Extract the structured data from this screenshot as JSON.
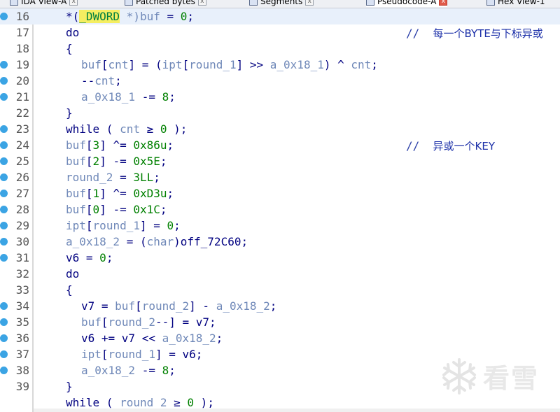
{
  "tabs": [
    {
      "label": "IDA View-A",
      "active": false
    },
    {
      "label": "Patched bytes",
      "active": false
    },
    {
      "label": "Segments",
      "active": false
    },
    {
      "label": "Pseudocode-A",
      "active": true
    },
    {
      "label": "Hex View-1",
      "active": false
    }
  ],
  "lines": [
    {
      "num": "16",
      "bp": true
    },
    {
      "num": "17",
      "bp": false
    },
    {
      "num": "18",
      "bp": false
    },
    {
      "num": "19",
      "bp": true
    },
    {
      "num": "20",
      "bp": true
    },
    {
      "num": "21",
      "bp": true
    },
    {
      "num": "22",
      "bp": false
    },
    {
      "num": "23",
      "bp": true
    },
    {
      "num": "24",
      "bp": true
    },
    {
      "num": "25",
      "bp": true
    },
    {
      "num": "26",
      "bp": true
    },
    {
      "num": "27",
      "bp": true
    },
    {
      "num": "28",
      "bp": true
    },
    {
      "num": "29",
      "bp": true
    },
    {
      "num": "30",
      "bp": true
    },
    {
      "num": "31",
      "bp": true
    },
    {
      "num": "32",
      "bp": false
    },
    {
      "num": "33",
      "bp": false
    },
    {
      "num": "34",
      "bp": true
    },
    {
      "num": "35",
      "bp": true
    },
    {
      "num": "36",
      "bp": true
    },
    {
      "num": "37",
      "bp": true
    },
    {
      "num": "38",
      "bp": true
    },
    {
      "num": "39",
      "bp": false
    },
    {
      "num": "",
      "bp": false
    }
  ],
  "code": {
    "l16": {
      "a": "*(",
      "hl": "_DWORD",
      "b": " *)",
      "c": "buf",
      "d": " = ",
      "e": "0",
      "f": ";"
    },
    "l17": "do",
    "l17_comment_slash": "//",
    "l17_comment": "每一个BYTE与下标异或",
    "l18": "{",
    "l19": {
      "a": "buf",
      "b": "[",
      "c": "cnt",
      "d": "] = (",
      "e": "ipt",
      "f": "[",
      "g": "round_1",
      "h": "] >> ",
      "i": "a_0x18_1",
      "j": ") ^ ",
      "k": "cnt",
      "l": ";"
    },
    "l20": {
      "a": "--",
      "b": "cnt",
      "c": ";"
    },
    "l21": {
      "a": "a_0x18_1",
      "b": " -= ",
      "c": "8",
      "d": ";"
    },
    "l22": "}",
    "l23": {
      "a": "while ( ",
      "b": "cnt",
      "c": " ≥ ",
      "d": "0",
      "e": " );"
    },
    "l24": {
      "a": "buf",
      "b": "[",
      "c": "3",
      "d": "] ^= ",
      "e": "0x86u",
      "f": ";"
    },
    "l24_comment_slash": "//",
    "l24_comment": "异或一个KEY",
    "l25": {
      "a": "buf",
      "b": "[",
      "c": "2",
      "d": "] -= ",
      "e": "0x5E",
      "f": ";"
    },
    "l26": {
      "a": "round_2",
      "b": " = ",
      "c": "3LL",
      "d": ";"
    },
    "l27": {
      "a": "buf",
      "b": "[",
      "c": "1",
      "d": "] ^= ",
      "e": "0xD3u",
      "f": ";"
    },
    "l28": {
      "a": "buf",
      "b": "[",
      "c": "0",
      "d": "] -= ",
      "e": "0x1C",
      "f": ";"
    },
    "l29": {
      "a": "ipt",
      "b": "[",
      "c": "round_1",
      "d": "] = ",
      "e": "0",
      "f": ";"
    },
    "l30": {
      "a": "a_0x18_2",
      "b": " = (",
      "c": "char",
      "d": ")",
      "e": "off_72C60",
      "f": ";"
    },
    "l31": {
      "a": "v6",
      "b": " = ",
      "c": "0",
      "d": ";"
    },
    "l32": "do",
    "l33": "{",
    "l34": {
      "a": "v7",
      "b": " = ",
      "c": "buf",
      "d": "[",
      "e": "round_2",
      "f": "] - ",
      "g": "a_0x18_2",
      "h": ";"
    },
    "l35": {
      "a": "buf",
      "b": "[",
      "c": "round_2",
      "d": "--] = ",
      "e": "v7",
      "f": ";"
    },
    "l36": {
      "a": "v6",
      "b": " += ",
      "c": "v7",
      "d": " << ",
      "e": "a_0x18_2",
      "f": ";"
    },
    "l37": {
      "a": "ipt",
      "b": "[",
      "c": "round_1",
      "d": "] = ",
      "e": "v6",
      "f": ";"
    },
    "l38": {
      "a": "a_0x18_2",
      "b": " -= ",
      "c": "8",
      "d": ";"
    },
    "l39": "}",
    "l40": {
      "a": "while ( ",
      "b": "round_2",
      "c": " ≥ ",
      "d": "0",
      "e": " );"
    }
  },
  "watermark": {
    "text": "看雪",
    "icon": "snowflake-icon"
  },
  "colors": {
    "keyword": "#000080",
    "number": "#008000",
    "variable": "#6f88b8",
    "highlight": "#f5ee61",
    "breakpoint": "#3ba4e4"
  }
}
